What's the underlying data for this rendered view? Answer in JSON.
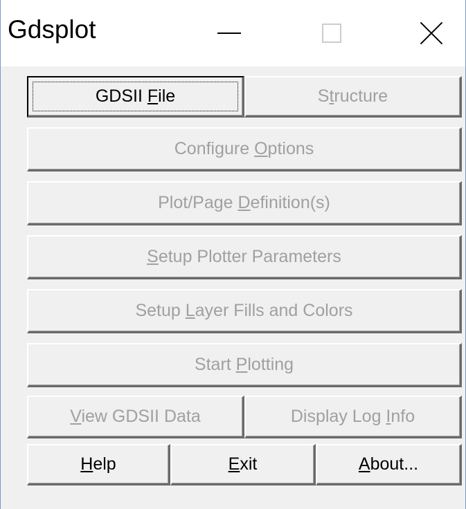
{
  "window": {
    "title": "Gdsplot"
  },
  "titlebar": {
    "minimize_icon": "minimize-icon",
    "maximize_icon": "maximize-icon",
    "close_icon": "close-icon"
  },
  "buttons": {
    "gdsii_file": {
      "pre": "GDSII ",
      "key": "F",
      "post": "ile",
      "enabled": true
    },
    "structure": {
      "pre": "S",
      "key": "t",
      "post": "ructure",
      "enabled": false
    },
    "configure_options": {
      "pre": "Configure ",
      "key": "O",
      "post": "ptions",
      "enabled": false
    },
    "plot_page_definitions": {
      "pre": "Plot/Page ",
      "key": "D",
      "post": "efinition(s)",
      "enabled": false
    },
    "setup_plotter_parameters": {
      "pre": "",
      "key": "S",
      "post": "etup Plotter Parameters",
      "enabled": false
    },
    "setup_layer_fills": {
      "pre": "Setup ",
      "key": "L",
      "post": "ayer Fills and Colors",
      "enabled": false
    },
    "start_plotting": {
      "pre": "Start ",
      "key": "P",
      "post": "lotting",
      "enabled": false
    },
    "view_gdsii_data": {
      "pre": "",
      "key": "V",
      "post": "iew GDSII Data",
      "enabled": false
    },
    "display_log_info": {
      "pre": "Display Log ",
      "key": "I",
      "post": "nfo",
      "enabled": false
    },
    "help": {
      "pre": "",
      "key": "H",
      "post": "elp",
      "enabled": true
    },
    "exit": {
      "pre": "",
      "key": "E",
      "post": "xit",
      "enabled": true
    },
    "about": {
      "pre": "",
      "key": "A",
      "post": "bout...",
      "enabled": true
    }
  },
  "colors": {
    "face": "#f0f0f0",
    "enabled_text": "#000000",
    "disabled_text": "#a0a0a0"
  }
}
